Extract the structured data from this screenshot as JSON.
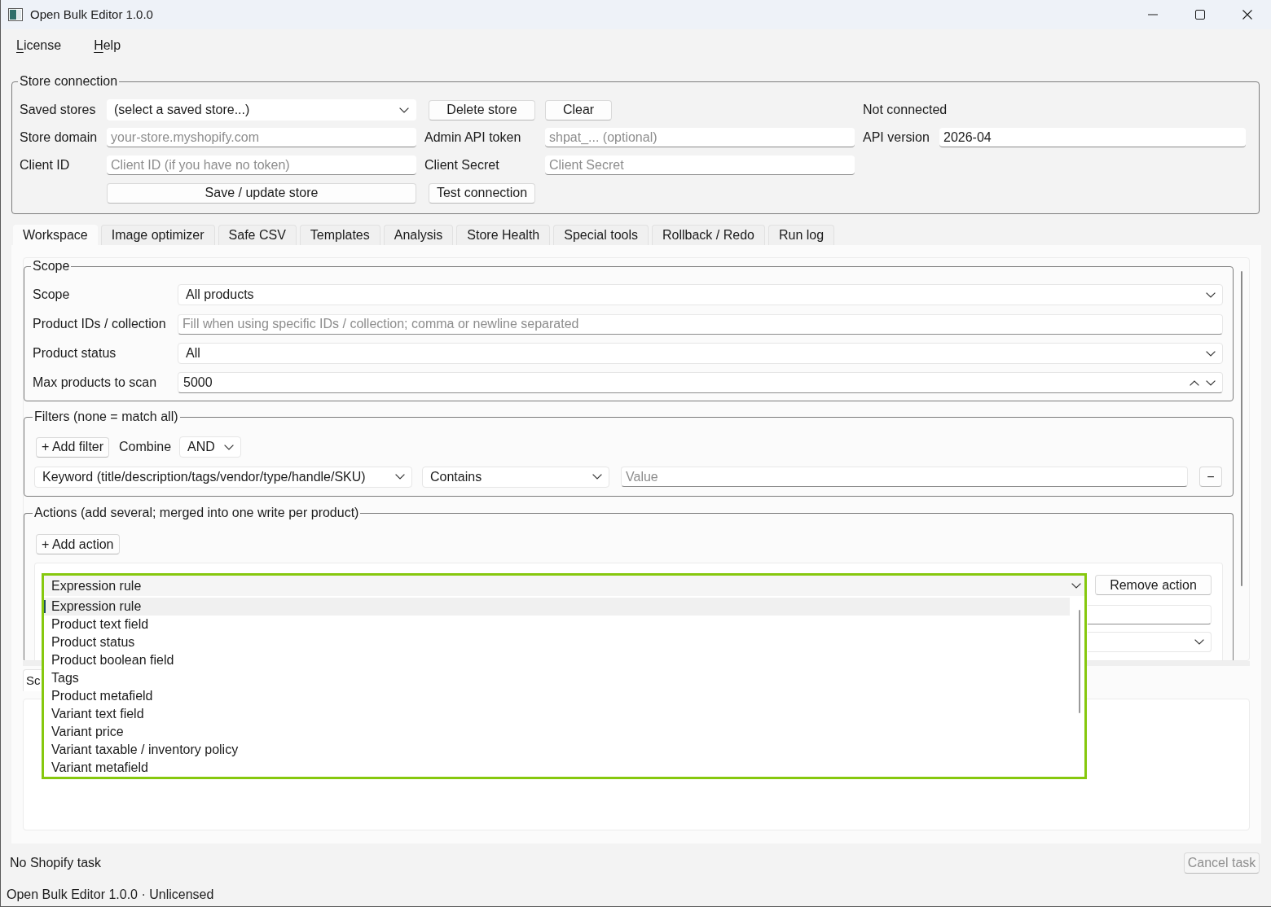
{
  "window": {
    "title": "Open Bulk Editor 1.0.0"
  },
  "menu": [
    {
      "label": "License",
      "mnemonic_underlined": true
    },
    {
      "label": "Help",
      "mnemonic_underlined": true
    }
  ],
  "store_connection": {
    "title": "Store connection",
    "saved_stores": {
      "label": "Saved stores",
      "value": "(select a saved store...)"
    },
    "delete_button": "Delete store",
    "clear_button": "Clear",
    "status": "Not connected",
    "store_domain": {
      "label": "Store domain",
      "placeholder": "your-store.myshopify.com"
    },
    "admin_api_token": {
      "label": "Admin API token",
      "placeholder": "shpat_... (optional)"
    },
    "api_version": {
      "label": "API version",
      "value": "2026-04"
    },
    "client_id": {
      "label": "Client ID",
      "placeholder": "Client ID (if you have no token)"
    },
    "client_secret": {
      "label": "Client Secret",
      "placeholder": "Client Secret"
    },
    "save_button": "Save / update store",
    "test_button": "Test connection"
  },
  "tabs": [
    {
      "label": "Workspace",
      "selected": true
    },
    {
      "label": "Image optimizer",
      "selected": false
    },
    {
      "label": "Safe CSV",
      "selected": false
    },
    {
      "label": "Templates",
      "selected": false
    },
    {
      "label": "Analysis",
      "selected": false
    },
    {
      "label": "Store Health",
      "selected": false
    },
    {
      "label": "Special tools",
      "selected": false
    },
    {
      "label": "Rollback / Redo",
      "selected": false
    },
    {
      "label": "Run log",
      "selected": false
    }
  ],
  "workspace": {
    "scope": {
      "title": "Scope",
      "rows": [
        {
          "kind": "select",
          "label": "Scope",
          "value": "All products"
        },
        {
          "kind": "input",
          "label": "Product IDs / collection",
          "placeholder": "Fill when using specific IDs / collection; comma or newline separated"
        },
        {
          "kind": "select",
          "label": "Product status",
          "value": "All"
        },
        {
          "kind": "spinbox",
          "label": "Max products to scan",
          "value": "5000"
        }
      ]
    },
    "filters": {
      "title": "Filters (none = match all)",
      "add_button": "+ Add filter",
      "combine_label": "Combine",
      "combine_value": "AND",
      "rows": [
        {
          "field": "Keyword (title/description/tags/vendor/type/handle/SKU)",
          "operator": "Contains",
          "value_placeholder": "Value",
          "remove_button": "−"
        }
      ]
    },
    "actions": {
      "title": "Actions (add several; merged into one write per product)",
      "add_button": "+ Add action",
      "items": [
        {
          "type": "Expression rule",
          "expanded": true,
          "remove_button": "Remove action",
          "options": [
            {
              "label": "Expression rule",
              "selected": true
            },
            {
              "label": "Product text field",
              "selected": false
            },
            {
              "label": "Product status",
              "selected": false
            },
            {
              "label": "Product boolean field",
              "selected": false
            },
            {
              "label": "Tags",
              "selected": false
            },
            {
              "label": "Product metafield",
              "selected": false
            },
            {
              "label": "Variant text field",
              "selected": false
            },
            {
              "label": "Variant price",
              "selected": false
            },
            {
              "label": "Variant taxable / inventory policy",
              "selected": false
            },
            {
              "label": "Variant metafield",
              "selected": false
            }
          ]
        }
      ]
    },
    "lower_tab": "Sc"
  },
  "status_bar": {
    "task": "No Shopify task",
    "cancel_button": {
      "label": "Cancel task",
      "disabled": true
    }
  },
  "footer": "Open Bulk Editor 1.0.0 · Unlicensed"
}
